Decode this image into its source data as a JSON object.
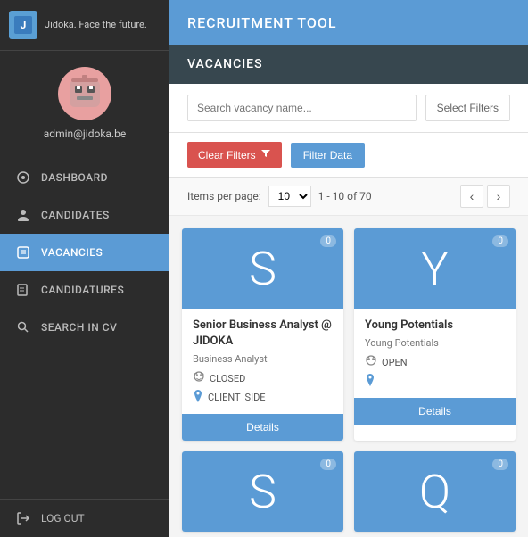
{
  "app": {
    "title": "RECRUITMENT TOOL",
    "logo_text": "Jidoka. Face the future."
  },
  "sidebar": {
    "username": "admin@jidoka.be",
    "nav_items": [
      {
        "id": "dashboard",
        "label": "DASHBOARD",
        "active": false
      },
      {
        "id": "candidates",
        "label": "CANDIDATES",
        "active": false
      },
      {
        "id": "vacancies",
        "label": "VACANCIES",
        "active": true
      },
      {
        "id": "candidatures",
        "label": "CANDIDATURES",
        "active": false
      },
      {
        "id": "search-in-cv",
        "label": "SEARCH IN CV",
        "active": false
      }
    ],
    "logout_label": "LOG OUT"
  },
  "content": {
    "section_title": "VACANCIES",
    "search_placeholder": "Search vacancy name...",
    "select_filters_label": "Select Filters",
    "clear_filters_label": "Clear Filters",
    "filter_data_label": "Filter Data",
    "pagination": {
      "items_per_page_label": "Items per page:",
      "per_page_value": "10",
      "range_text": "1 - 10 of 70"
    },
    "cards": [
      {
        "letter": "S",
        "badge": "0",
        "title": "Senior Business Analyst @ JIDOKA",
        "subtitle": "Business Analyst",
        "status": "CLOSED",
        "location": "CLIENT_SIDE",
        "details_label": "Details"
      },
      {
        "letter": "Y",
        "badge": "0",
        "title": "Young Potentials",
        "subtitle": "Young Potentials",
        "status": "OPEN",
        "location": "",
        "details_label": "Details"
      },
      {
        "letter": "S",
        "badge": "0",
        "title": "",
        "subtitle": "",
        "status": "",
        "location": "",
        "details_label": ""
      },
      {
        "letter": "Q",
        "badge": "0",
        "title": "",
        "subtitle": "",
        "status": "",
        "location": "",
        "details_label": ""
      }
    ]
  }
}
